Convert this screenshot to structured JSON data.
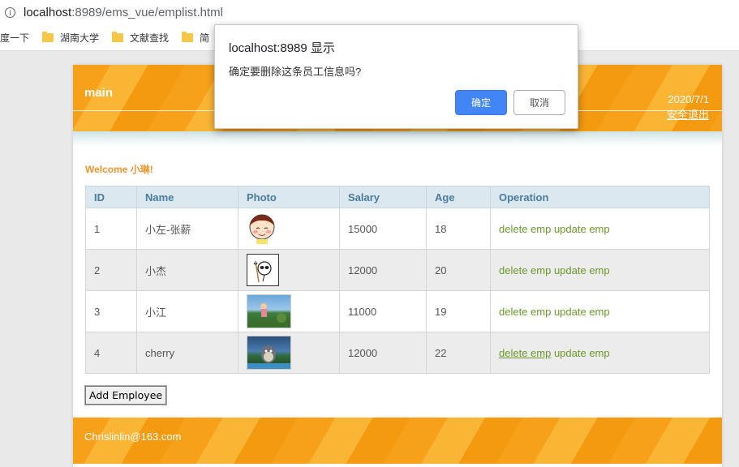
{
  "browser": {
    "url_host": "localhost",
    "url_rest": ":8989/ems_vue/emplist.html",
    "bookmarks": [
      "度一下",
      "湖南大学",
      "文献查找",
      "简"
    ]
  },
  "header": {
    "brand": "main",
    "date": "2020/7/1",
    "logout": "安全退出"
  },
  "welcome": "Welcome 小琳!",
  "table": {
    "columns": [
      "ID",
      "Name",
      "Photo",
      "Salary",
      "Age",
      "Operation"
    ],
    "rows": [
      {
        "id": "1",
        "name": "小左-张薪",
        "salary": "15000",
        "age": "18",
        "delete": "delete emp",
        "update": "update emp"
      },
      {
        "id": "2",
        "name": "小杰",
        "salary": "12000",
        "age": "20",
        "delete": "delete emp",
        "update": "update emp"
      },
      {
        "id": "3",
        "name": "小江",
        "salary": "11000",
        "age": "19",
        "delete": "delete emp",
        "update": "update emp"
      },
      {
        "id": "4",
        "name": "cherry",
        "salary": "12000",
        "age": "22",
        "delete": "delete emp",
        "update": "update emp"
      }
    ]
  },
  "add_button": "Add Employee",
  "footer": {
    "email": "Chrislinlin@163.com"
  },
  "dialog": {
    "title": "localhost:8989 显示",
    "message": "确定要删除这条员工信息吗?",
    "ok": "确定",
    "cancel": "取消"
  },
  "colors": {
    "accent": "#f7a11a",
    "link": "#6b9a2a",
    "primary_button": "#4285f4"
  }
}
